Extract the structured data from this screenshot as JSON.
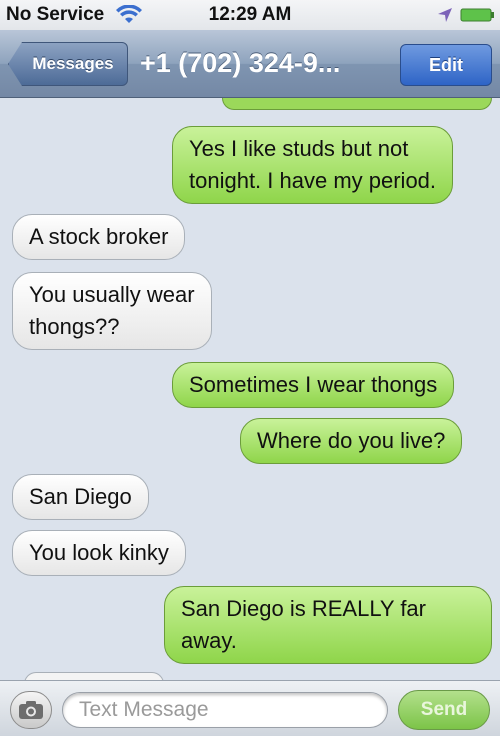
{
  "status_bar": {
    "carrier": "No Service",
    "time": "12:29 AM"
  },
  "nav": {
    "back_label": "Messages",
    "title": "+1 (702) 324-9...",
    "edit_label": "Edit"
  },
  "messages": [
    {
      "direction": "out",
      "lines": [
        "Yes I like studs but not",
        "tonight. I have my period."
      ]
    },
    {
      "direction": "in",
      "lines": [
        "A stock broker"
      ]
    },
    {
      "direction": "in",
      "lines": [
        "You usually wear",
        "thongs??"
      ]
    },
    {
      "direction": "out",
      "lines": [
        "Sometimes I wear thongs"
      ]
    },
    {
      "direction": "out",
      "lines": [
        "Where do you live?"
      ]
    },
    {
      "direction": "in",
      "lines": [
        "San Diego"
      ]
    },
    {
      "direction": "in",
      "lines": [
        "You look kinky"
      ]
    },
    {
      "direction": "out",
      "lines": [
        "San Diego is REALLY far",
        "away."
      ]
    }
  ],
  "input": {
    "placeholder": "Text Message",
    "send_label": "Send"
  },
  "colors": {
    "outgoing_bubble": "#a8e26a",
    "incoming_bubble": "#f4f4f4",
    "background": "#dbe2ec",
    "nav_bar": "#8ea3bd",
    "edit_button": "#3f74d0"
  },
  "icons": [
    "wifi-icon",
    "location-icon",
    "battery-icon",
    "camera-icon"
  ]
}
